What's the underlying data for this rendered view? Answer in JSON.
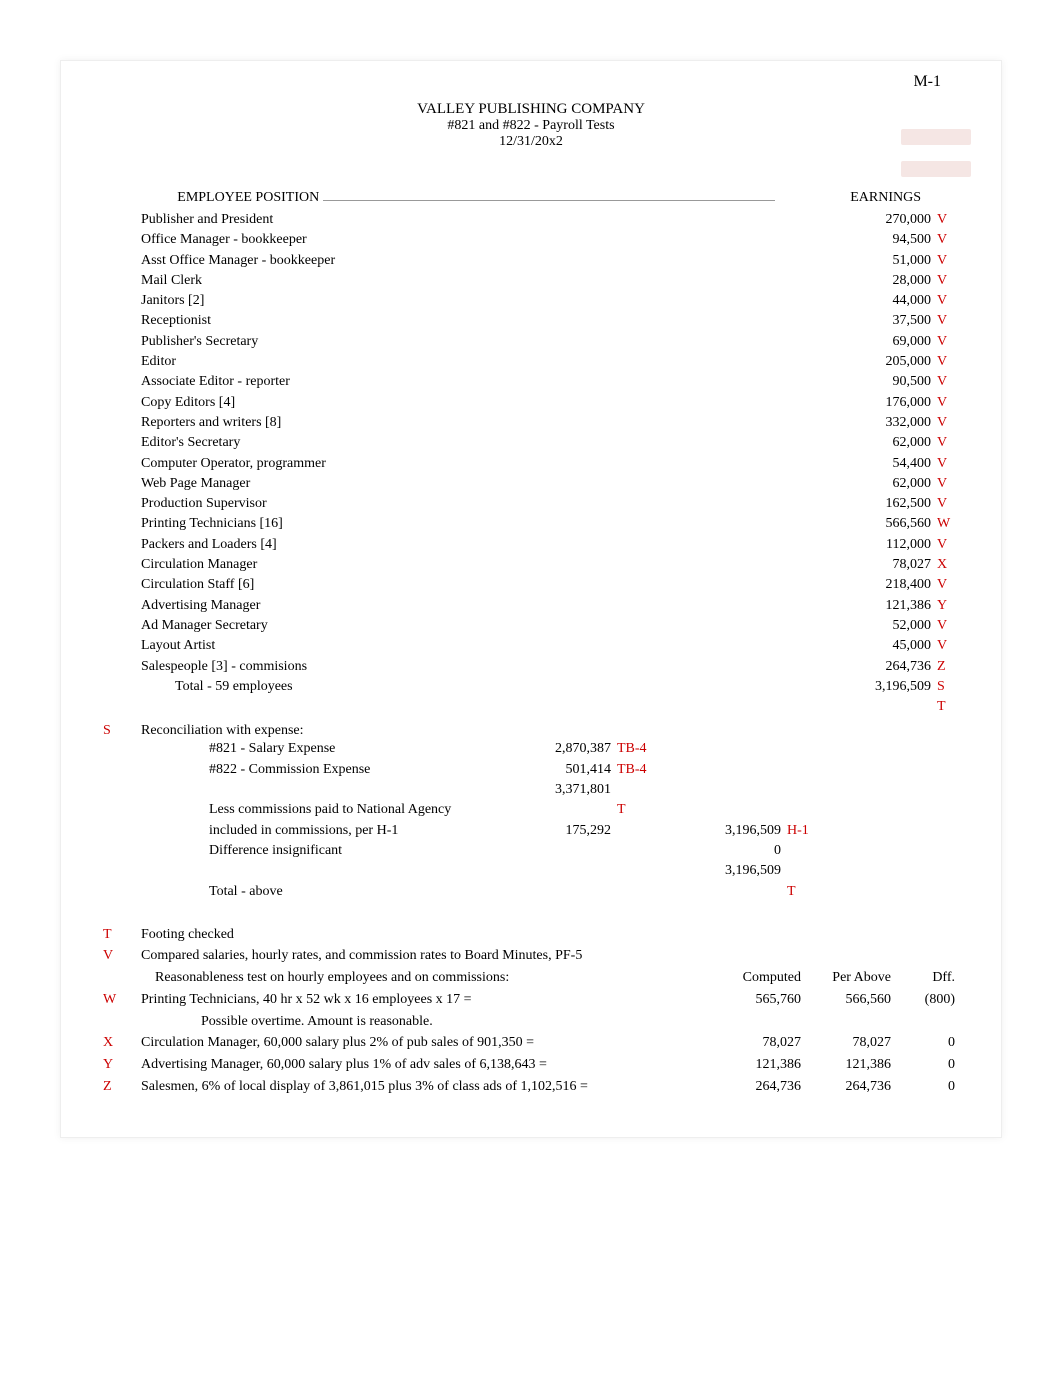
{
  "corner": "M-1",
  "header": {
    "company": "VALLEY PUBLISHING COMPANY",
    "subtitle": "#821 and #822 - Payroll Tests",
    "date": "12/31/20x2"
  },
  "column_headers": {
    "position": "EMPLOYEE POSITION",
    "earnings": "EARNINGS"
  },
  "employees": [
    {
      "position": "Publisher and President",
      "earnings": "270,000",
      "tick": "V"
    },
    {
      "position": "Office Manager - bookkeeper",
      "earnings": "94,500",
      "tick": "V"
    },
    {
      "position": "Asst Office Manager - bookkeeper",
      "earnings": "51,000",
      "tick": "V"
    },
    {
      "position": "Mail Clerk",
      "earnings": "28,000",
      "tick": "V"
    },
    {
      "position": "Janitors [2]",
      "earnings": "44,000",
      "tick": "V"
    },
    {
      "position": "Receptionist",
      "earnings": "37,500",
      "tick": "V"
    },
    {
      "position": "Publisher's Secretary",
      "earnings": "69,000",
      "tick": "V"
    },
    {
      "position": "Editor",
      "earnings": "205,000",
      "tick": "V"
    },
    {
      "position": "Associate Editor - reporter",
      "earnings": "90,500",
      "tick": "V"
    },
    {
      "position": "Copy Editors [4]",
      "earnings": "176,000",
      "tick": "V"
    },
    {
      "position": "Reporters and writers [8]",
      "earnings": "332,000",
      "tick": "V"
    },
    {
      "position": "Editor's Secretary",
      "earnings": "62,000",
      "tick": "V"
    },
    {
      "position": "Computer Operator, programmer",
      "earnings": "54,400",
      "tick": "V"
    },
    {
      "position": "Web Page Manager",
      "earnings": "62,000",
      "tick": "V"
    },
    {
      "position": "Production Supervisor",
      "earnings": "162,500",
      "tick": "V"
    },
    {
      "position": "Printing Technicians [16]",
      "earnings": "566,560",
      "tick": "W"
    },
    {
      "position": "Packers and Loaders [4]",
      "earnings": "112,000",
      "tick": "V"
    },
    {
      "position": "Circulation Manager",
      "earnings": "78,027",
      "tick": "X"
    },
    {
      "position": "Circulation Staff [6]",
      "earnings": "218,400",
      "tick": "V"
    },
    {
      "position": "Advertising Manager",
      "earnings": "121,386",
      "tick": "Y"
    },
    {
      "position": "Ad Manager Secretary",
      "earnings": "52,000",
      "tick": "V"
    },
    {
      "position": "Layout Artist",
      "earnings": "45,000",
      "tick": "V"
    },
    {
      "position": "Salespeople [3] - commisions",
      "earnings": "264,736",
      "tick": "Z"
    }
  ],
  "total_row": {
    "label": "Total - 59 employees",
    "earnings": "3,196,509",
    "tick": "S"
  },
  "post_total_tick": "T",
  "recon": {
    "section_tick": "S",
    "title": "Reconciliation with expense:",
    "rows": [
      {
        "lbl": "#821 - Salary Expense",
        "val": "2,870,387",
        "ref": "TB-4"
      },
      {
        "lbl": "#822 - Commission Expense",
        "val": "501,414",
        "ref": "TB-4"
      },
      {
        "lbl": "",
        "val": "3,371,801",
        "ref": ""
      },
      {
        "lbl": "Less commissions paid to National Agency",
        "val": "",
        "ref": "T"
      },
      {
        "lbl": "included in commissions, per H-1",
        "val": "175,292",
        "ref": "",
        "val2": "3,196,509",
        "ref2": "H-1"
      },
      {
        "lbl": "Difference insignificant",
        "val": "",
        "ref": "",
        "val2": "0",
        "ref2": ""
      },
      {
        "lbl": "",
        "val": "",
        "ref": "",
        "val2": "3,196,509",
        "ref2": ""
      },
      {
        "lbl": "Total - above",
        "val": "",
        "ref": "",
        "val2": "",
        "ref2": "T"
      }
    ]
  },
  "notes_header": {
    "computed": "Computed",
    "perabove": "Per Above",
    "diff": "Dff."
  },
  "notes": [
    {
      "tick": "T",
      "text": "Footing checked"
    },
    {
      "tick": "V",
      "text": "Compared salaries, hourly rates, and commission rates to Board Minutes, PF-5"
    },
    {
      "tick": "",
      "text": "Reasonableness test on hourly employees and on commissions:",
      "c1": "",
      "c2": "",
      "c3": ""
    },
    {
      "tick": "W",
      "text": "Printing Technicians, 40 hr x 52 wk x 16 employees x 17 =",
      "c1": "565,760",
      "c2": "566,560",
      "c3": "(800)"
    },
    {
      "tick": "",
      "text": "Possible overtime. Amount is reasonable."
    },
    {
      "tick": "X",
      "text": "Circulation Manager, 60,000 salary plus 2% of pub sales of 901,350 =",
      "c1": "78,027",
      "c2": "78,027",
      "c3": "0"
    },
    {
      "tick": "Y",
      "text": "Advertising Manager, 60,000 salary plus 1% of adv sales of 6,138,643 =",
      "c1": "121,386",
      "c2": "121,386",
      "c3": "0"
    },
    {
      "tick": "Z",
      "text": "Salesmen, 6% of local display of 3,861,015 plus 3% of class ads of 1,102,516 =",
      "c1": "264,736",
      "c2": "264,736",
      "c3": "0"
    }
  ]
}
